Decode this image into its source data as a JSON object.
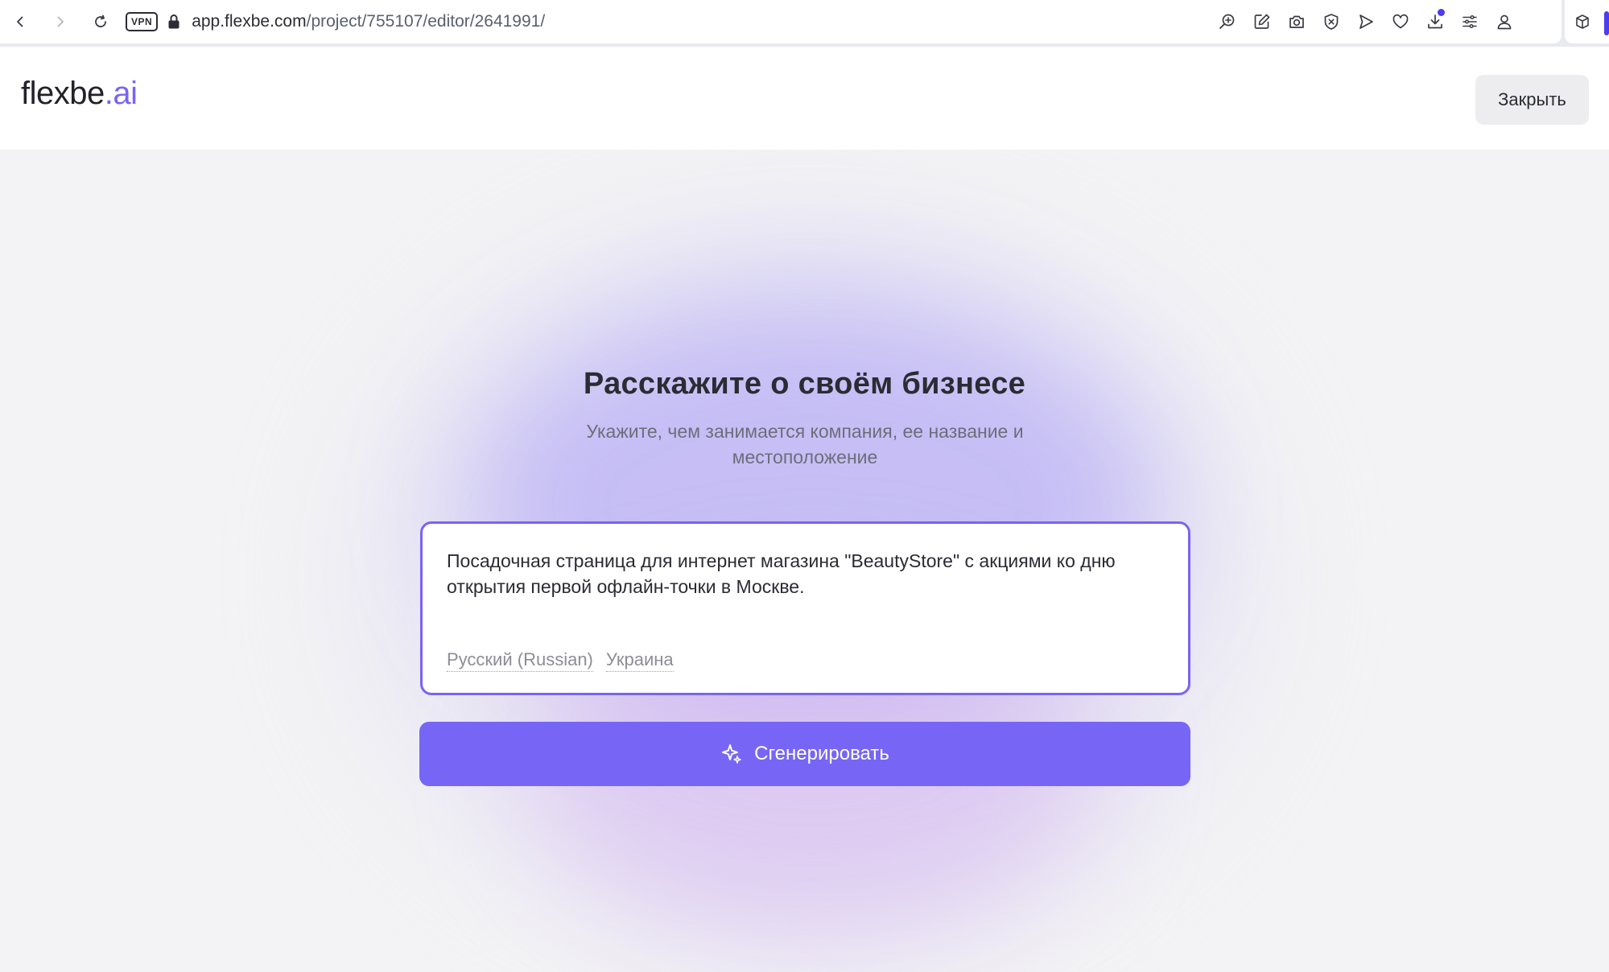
{
  "browser": {
    "vpn_label": "VPN",
    "url_host": "app.flexbe.com",
    "url_path": "/project/755107/editor/2641991/",
    "icons": [
      "back-icon",
      "forward-icon",
      "reload-icon",
      "lock-icon",
      "zoom-icon",
      "edit-icon",
      "camera-icon",
      "shield-icon",
      "send-icon",
      "heart-icon",
      "download-icon",
      "settings-icon",
      "profile-icon",
      "extensions-icon"
    ]
  },
  "header": {
    "logo_main": "flexbe",
    "logo_suffix": ".ai",
    "close_label": "Закрыть"
  },
  "main": {
    "title": "Расскажите о своём бизнесе",
    "subtitle": "Укажите, чем занимается компания, ее название и местоположение",
    "prompt_value": "Посадочная страница для интернет магазина \"BeautyStore\" с акциями ко дню открытия первой офлайн-точки в Москве.",
    "language_label": "Русский (Russian)",
    "region_label": "Украина",
    "generate_label": "Сгенерировать"
  },
  "colors": {
    "accent": "#7766f5",
    "logo_accent": "#7a63f5",
    "background": "#f3f3f5"
  }
}
